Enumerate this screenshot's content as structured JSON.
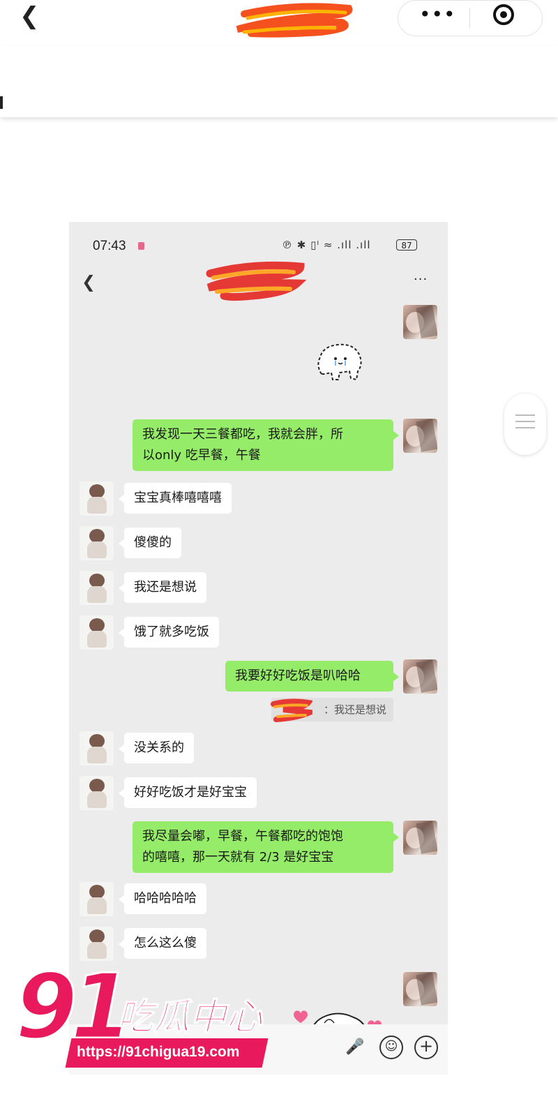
{
  "outer": {
    "back_icon": "chevron-left-icon",
    "more_icon": "ellipsis-icon",
    "close_icon": "target-icon"
  },
  "phone": {
    "status": {
      "time": "07:43",
      "icons": "℗ ✱ ▯ᴵ ≈ .ıll .ıll",
      "battery": "87"
    },
    "more": "···"
  },
  "messages": [
    {
      "side": "right",
      "lines": [
        "我发现一天三餐都吃，我就会胖，所",
        "以only 吃早餐，午餐"
      ]
    },
    {
      "side": "left",
      "lines": [
        "宝宝真棒嘻嘻嘻"
      ]
    },
    {
      "side": "left",
      "lines": [
        "傻傻的"
      ]
    },
    {
      "side": "left",
      "lines": [
        "我还是想说"
      ]
    },
    {
      "side": "left",
      "lines": [
        "饿了就多吃饭"
      ]
    },
    {
      "side": "right",
      "lines": [
        "我要好好吃饭是叭哈哈"
      ]
    },
    {
      "side": "left",
      "lines": [
        "没关系的"
      ]
    },
    {
      "side": "left",
      "lines": [
        "好好吃饭才是好宝宝"
      ]
    },
    {
      "side": "right",
      "lines": [
        "我尽量会嘟，早餐，午餐都吃的饱饱",
        "的嘻嘻，那一天就有 2/3 是好宝宝"
      ]
    },
    {
      "side": "left",
      "lines": [
        "哈哈哈哈哈"
      ]
    },
    {
      "side": "left",
      "lines": [
        "怎么这么傻"
      ]
    }
  ],
  "quote": "：我还是想说",
  "watermark": {
    "number": "91",
    "name": "吃瓜中心",
    "url": "https://91chigua19.com"
  },
  "colors": {
    "green_bubble": "#95ec69",
    "watermark": "#e8195c",
    "chat_bg": "#ececec"
  }
}
